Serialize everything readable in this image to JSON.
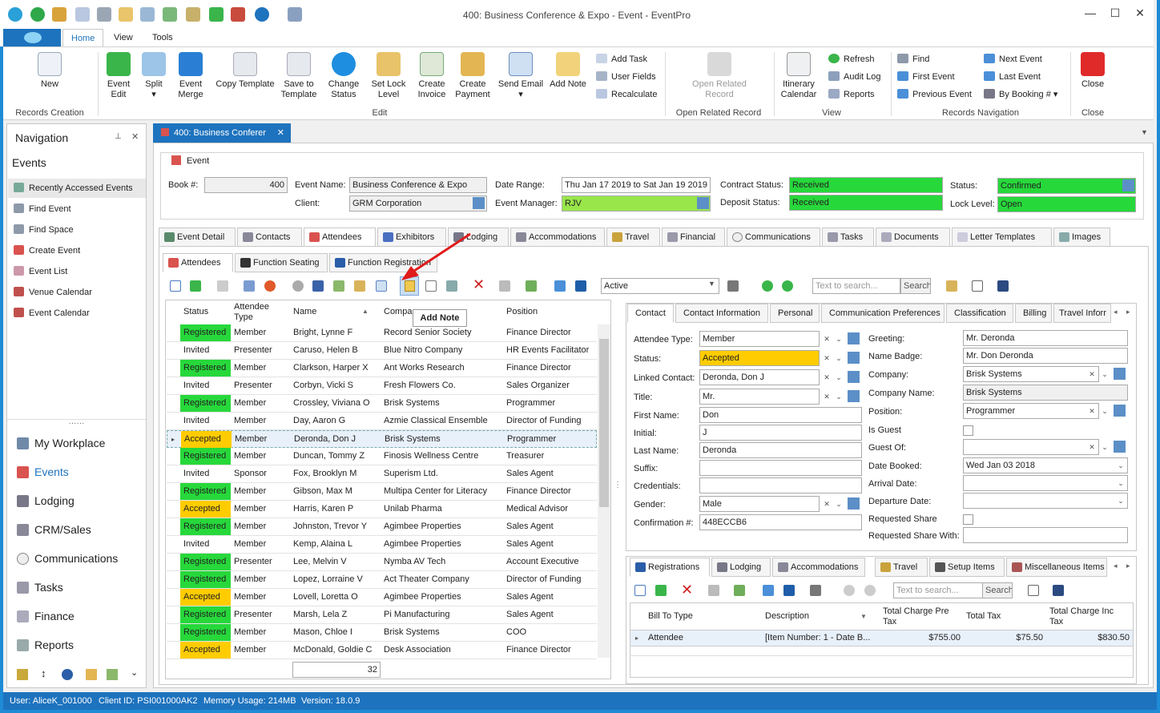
{
  "window": {
    "title": "400: Business Conference & Expo - Event - EventPro"
  },
  "ribbon_tabs": [
    "Home",
    "View",
    "Tools"
  ],
  "ribbon": {
    "records_creation": {
      "label": "Records Creation",
      "new": "New"
    },
    "edit_group": {
      "label": "Edit",
      "buttons": [
        "Event\nEdit",
        "Split",
        "Event\nMerge",
        "Copy Template",
        "Save to\nTemplate",
        "Change\nStatus",
        "Set Lock\nLevel",
        "Create\nInvoice",
        "Create\nPayment",
        "Send Email",
        "Add Note"
      ],
      "small": [
        "Add Task",
        "User Fields",
        "Recalculate"
      ]
    },
    "open_related": {
      "label": "Open Related Record",
      "button": "Open Related\nRecord"
    },
    "view_group": {
      "label": "View",
      "itinerary": "Itinerary\nCalendar",
      "small": [
        "Refresh",
        "Audit Log",
        "Reports"
      ]
    },
    "records_nav": {
      "label": "Records Navigation",
      "col1": [
        "Find",
        "First Event",
        "Previous Event"
      ],
      "col2": [
        "Next Event",
        "Last Event",
        "By Booking #"
      ]
    },
    "close_group": {
      "label": "Close",
      "button": "Close"
    }
  },
  "nav": {
    "title": "Navigation",
    "section": "Events",
    "items": [
      "Recently Accessed Events",
      "Find Event",
      "Find Space",
      "Create Event",
      "Event List",
      "Venue Calendar",
      "Event Calendar"
    ],
    "modules": [
      "My Workplace",
      "Events",
      "Lodging",
      "CRM/Sales",
      "Communications",
      "Tasks",
      "Finance",
      "Reports"
    ]
  },
  "doc_tab": "400: Business Conferer",
  "event": {
    "section": "Event",
    "book_label": "Book #:",
    "book": "400",
    "name_label": "Event Name:",
    "name": "Business Conference & Expo",
    "client_label": "Client:",
    "client": "GRM Corporation",
    "date_label": "Date Range:",
    "date": "Thu Jan 17 2019 to Sat Jan 19 2019",
    "manager_label": "Event Manager:",
    "manager": "RJV",
    "contract_label": "Contract Status:",
    "contract": "Received",
    "deposit_label": "Deposit Status:",
    "deposit": "Received",
    "status_label": "Status:",
    "status": "Confirmed",
    "lock_label": "Lock Level:",
    "lock": "Open"
  },
  "main_tabs": [
    "Event Detail",
    "Contacts",
    "Attendees",
    "Exhibitors",
    "Lodging",
    "Accommodations",
    "Travel",
    "Financial",
    "Communications",
    "Tasks",
    "Documents",
    "Letter Templates",
    "Images"
  ],
  "sub_tabs": [
    "Attendees",
    "Function Seating",
    "Function Registration"
  ],
  "toolbar": {
    "filter_value": "Active",
    "search_placeholder": "Text to search...",
    "search_button": "Search",
    "tooltip": "Add Note"
  },
  "grid": {
    "headers": [
      "Status",
      "Attendee\nType",
      "Name",
      "Compa",
      "Position"
    ],
    "rows": [
      [
        "Registered",
        "Member",
        "Bright, Lynne F",
        "Record Senior Society",
        "Finance Director"
      ],
      [
        "Invited",
        "Presenter",
        "Caruso, Helen B",
        "Blue Nitro Company",
        "HR Events Facilitator"
      ],
      [
        "Registered",
        "Member",
        "Clarkson, Harper X",
        "Ant Works Research",
        "Finance Director"
      ],
      [
        "Invited",
        "Presenter",
        "Corbyn, Vicki S",
        "Fresh Flowers Co.",
        "Sales Organizer"
      ],
      [
        "Registered",
        "Member",
        "Crossley, Viviana O",
        "Brisk Systems",
        "Programmer"
      ],
      [
        "Invited",
        "Member",
        "Day, Aaron G",
        "Azmie Classical Ensemble",
        "Director of Funding"
      ],
      [
        "Accepted",
        "Member",
        "Deronda, Don J",
        "Brisk Systems",
        "Programmer"
      ],
      [
        "Registered",
        "Member",
        "Duncan, Tommy Z",
        "Finosis Wellness Centre",
        "Treasurer"
      ],
      [
        "Invited",
        "Sponsor",
        "Fox, Brooklyn M",
        "Superism Ltd.",
        "Sales Agent"
      ],
      [
        "Registered",
        "Member",
        "Gibson, Max M",
        "Multipa Center for Literacy",
        "Finance Director"
      ],
      [
        "Accepted",
        "Member",
        "Harris, Karen P",
        "Unilab Pharma",
        "Medical Advisor"
      ],
      [
        "Registered",
        "Member",
        "Johnston, Trevor Y",
        "Agimbee Properties",
        "Sales Agent"
      ],
      [
        "Invited",
        "Member",
        "Kemp, Alaina L",
        "Agimbee Properties",
        "Sales Agent"
      ],
      [
        "Registered",
        "Presenter",
        "Lee, Melvin V",
        "Nymba AV Tech",
        "Account Executive"
      ],
      [
        "Registered",
        "Member",
        "Lopez, Lorraine V",
        "Act Theater Company",
        "Director of Funding"
      ],
      [
        "Accepted",
        "Member",
        "Lovell, Loretta O",
        "Agimbee Properties",
        "Sales Agent"
      ],
      [
        "Registered",
        "Presenter",
        "Marsh, Lela Z",
        "Pi Manufacturing",
        "Sales Agent"
      ],
      [
        "Registered",
        "Member",
        "Mason, Chloe I",
        "Brisk Systems",
        "COO"
      ],
      [
        "Accepted",
        "Member",
        "McDonald, Goldie C",
        "Desk Association",
        "Finance Director"
      ]
    ],
    "count": "32"
  },
  "detail_tabs": [
    "Contact",
    "Contact Information",
    "Personal",
    "Communication Preferences",
    "Classification",
    "Billing",
    "Travel Inforr"
  ],
  "contact": {
    "left_labels": [
      "Attendee Type:",
      "Status:",
      "Linked Contact:",
      "Title:",
      "First Name:",
      "Initial:",
      "Last Name:",
      "Suffix:",
      "Credentials:",
      "Gender:",
      "Confirmation #:"
    ],
    "left_values": [
      "Member",
      "Accepted",
      "Deronda, Don J",
      "Mr.",
      "Don",
      "J",
      "Deronda",
      "",
      "",
      "Male",
      "448ECCB6"
    ],
    "right_labels": [
      "Greeting:",
      "Name Badge:",
      "Company:",
      "Company Name:",
      "Position:",
      "Is Guest",
      "Guest Of:",
      "Date Booked:",
      "Arrival Date:",
      "Departure Date:",
      "Requested Share",
      "Requested Share With:"
    ],
    "right_values": [
      "Mr. Deronda",
      "Mr. Don Deronda",
      "Brisk Systems",
      "Brisk Systems",
      "Programmer",
      "",
      "",
      "Wed Jan 03 2018",
      "",
      "",
      "",
      ""
    ]
  },
  "bottom_tabs": [
    "Registrations",
    "Lodging",
    "Accommodations",
    "Travel",
    "Setup Items",
    "Miscellaneous Items"
  ],
  "bottom_toolbar": {
    "search_placeholder": "Text to search...",
    "search_button": "Search"
  },
  "reg_grid": {
    "headers": [
      "Bill To Type",
      "Description",
      "Total Charge Pre\nTax",
      "Total Tax",
      "Total Charge Inc\nTax"
    ],
    "row": [
      "Attendee",
      "[Item Number: 1 - Date B...",
      "$755.00",
      "$75.50",
      "$830.50"
    ]
  },
  "status_bar": {
    "user": "User: AliceK_001000",
    "client": "Client ID: PSI001000AK2",
    "memory": "Memory Usage: 214MB",
    "version": "Version: 18.0.9"
  },
  "colors": {
    "accent": "#1e73be",
    "registered": "#27d83b",
    "accepted": "#ffcc00",
    "manager": "#99e64b",
    "arrow": "#e01b1b"
  }
}
